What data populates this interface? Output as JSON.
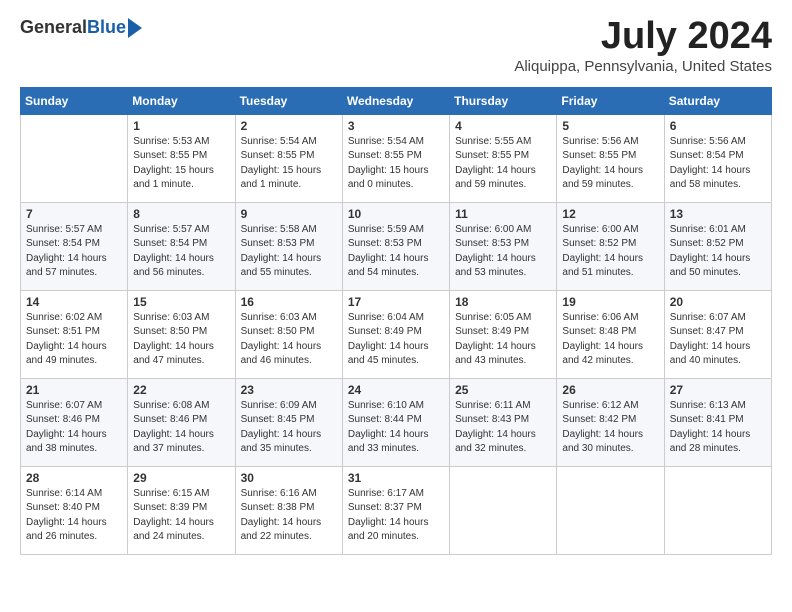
{
  "header": {
    "logo_general": "General",
    "logo_blue": "Blue",
    "month_title": "July 2024",
    "location": "Aliquippa, Pennsylvania, United States"
  },
  "weekdays": [
    "Sunday",
    "Monday",
    "Tuesday",
    "Wednesday",
    "Thursday",
    "Friday",
    "Saturday"
  ],
  "weeks": [
    [
      {
        "day": "",
        "info": ""
      },
      {
        "day": "1",
        "info": "Sunrise: 5:53 AM\nSunset: 8:55 PM\nDaylight: 15 hours\nand 1 minute."
      },
      {
        "day": "2",
        "info": "Sunrise: 5:54 AM\nSunset: 8:55 PM\nDaylight: 15 hours\nand 1 minute."
      },
      {
        "day": "3",
        "info": "Sunrise: 5:54 AM\nSunset: 8:55 PM\nDaylight: 15 hours\nand 0 minutes."
      },
      {
        "day": "4",
        "info": "Sunrise: 5:55 AM\nSunset: 8:55 PM\nDaylight: 14 hours\nand 59 minutes."
      },
      {
        "day": "5",
        "info": "Sunrise: 5:56 AM\nSunset: 8:55 PM\nDaylight: 14 hours\nand 59 minutes."
      },
      {
        "day": "6",
        "info": "Sunrise: 5:56 AM\nSunset: 8:54 PM\nDaylight: 14 hours\nand 58 minutes."
      }
    ],
    [
      {
        "day": "7",
        "info": "Sunrise: 5:57 AM\nSunset: 8:54 PM\nDaylight: 14 hours\nand 57 minutes."
      },
      {
        "day": "8",
        "info": "Sunrise: 5:57 AM\nSunset: 8:54 PM\nDaylight: 14 hours\nand 56 minutes."
      },
      {
        "day": "9",
        "info": "Sunrise: 5:58 AM\nSunset: 8:53 PM\nDaylight: 14 hours\nand 55 minutes."
      },
      {
        "day": "10",
        "info": "Sunrise: 5:59 AM\nSunset: 8:53 PM\nDaylight: 14 hours\nand 54 minutes."
      },
      {
        "day": "11",
        "info": "Sunrise: 6:00 AM\nSunset: 8:53 PM\nDaylight: 14 hours\nand 53 minutes."
      },
      {
        "day": "12",
        "info": "Sunrise: 6:00 AM\nSunset: 8:52 PM\nDaylight: 14 hours\nand 51 minutes."
      },
      {
        "day": "13",
        "info": "Sunrise: 6:01 AM\nSunset: 8:52 PM\nDaylight: 14 hours\nand 50 minutes."
      }
    ],
    [
      {
        "day": "14",
        "info": "Sunrise: 6:02 AM\nSunset: 8:51 PM\nDaylight: 14 hours\nand 49 minutes."
      },
      {
        "day": "15",
        "info": "Sunrise: 6:03 AM\nSunset: 8:50 PM\nDaylight: 14 hours\nand 47 minutes."
      },
      {
        "day": "16",
        "info": "Sunrise: 6:03 AM\nSunset: 8:50 PM\nDaylight: 14 hours\nand 46 minutes."
      },
      {
        "day": "17",
        "info": "Sunrise: 6:04 AM\nSunset: 8:49 PM\nDaylight: 14 hours\nand 45 minutes."
      },
      {
        "day": "18",
        "info": "Sunrise: 6:05 AM\nSunset: 8:49 PM\nDaylight: 14 hours\nand 43 minutes."
      },
      {
        "day": "19",
        "info": "Sunrise: 6:06 AM\nSunset: 8:48 PM\nDaylight: 14 hours\nand 42 minutes."
      },
      {
        "day": "20",
        "info": "Sunrise: 6:07 AM\nSunset: 8:47 PM\nDaylight: 14 hours\nand 40 minutes."
      }
    ],
    [
      {
        "day": "21",
        "info": "Sunrise: 6:07 AM\nSunset: 8:46 PM\nDaylight: 14 hours\nand 38 minutes."
      },
      {
        "day": "22",
        "info": "Sunrise: 6:08 AM\nSunset: 8:46 PM\nDaylight: 14 hours\nand 37 minutes."
      },
      {
        "day": "23",
        "info": "Sunrise: 6:09 AM\nSunset: 8:45 PM\nDaylight: 14 hours\nand 35 minutes."
      },
      {
        "day": "24",
        "info": "Sunrise: 6:10 AM\nSunset: 8:44 PM\nDaylight: 14 hours\nand 33 minutes."
      },
      {
        "day": "25",
        "info": "Sunrise: 6:11 AM\nSunset: 8:43 PM\nDaylight: 14 hours\nand 32 minutes."
      },
      {
        "day": "26",
        "info": "Sunrise: 6:12 AM\nSunset: 8:42 PM\nDaylight: 14 hours\nand 30 minutes."
      },
      {
        "day": "27",
        "info": "Sunrise: 6:13 AM\nSunset: 8:41 PM\nDaylight: 14 hours\nand 28 minutes."
      }
    ],
    [
      {
        "day": "28",
        "info": "Sunrise: 6:14 AM\nSunset: 8:40 PM\nDaylight: 14 hours\nand 26 minutes."
      },
      {
        "day": "29",
        "info": "Sunrise: 6:15 AM\nSunset: 8:39 PM\nDaylight: 14 hours\nand 24 minutes."
      },
      {
        "day": "30",
        "info": "Sunrise: 6:16 AM\nSunset: 8:38 PM\nDaylight: 14 hours\nand 22 minutes."
      },
      {
        "day": "31",
        "info": "Sunrise: 6:17 AM\nSunset: 8:37 PM\nDaylight: 14 hours\nand 20 minutes."
      },
      {
        "day": "",
        "info": ""
      },
      {
        "day": "",
        "info": ""
      },
      {
        "day": "",
        "info": ""
      }
    ]
  ]
}
